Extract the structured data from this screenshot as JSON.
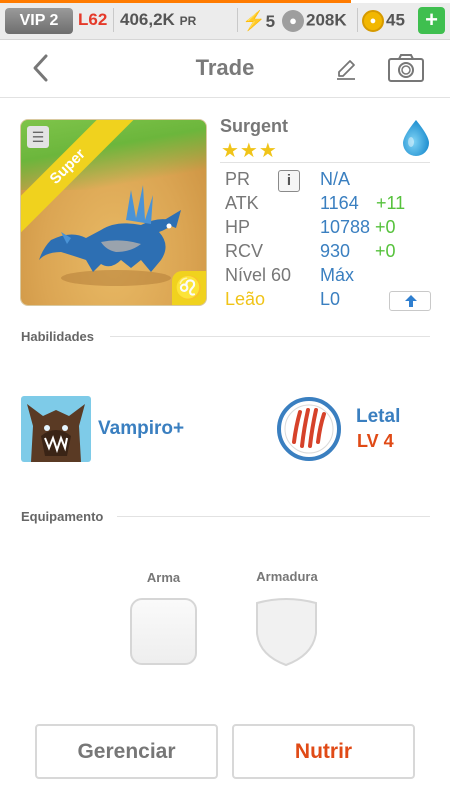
{
  "status_bar": {
    "vip": "VIP 2",
    "level": "L62",
    "power": "406,2K",
    "power_unit": "PR",
    "energy": "5",
    "food": "208K",
    "gold": "45",
    "add_label": "+"
  },
  "header": {
    "title": "Trade",
    "back_icon": "chevron-left-icon",
    "edit_icon": "pencil-icon",
    "camera_icon": "camera-icon"
  },
  "monster": {
    "name": "Surgent",
    "stars": "★★★",
    "badge": "Super",
    "element_icon": "water-drop-icon",
    "zodiac_icon": "leo-icon",
    "zodiac_glyph": "♌",
    "card_tag_glyph": "☰",
    "stats": {
      "pr_label": "PR",
      "pr_info": "i",
      "pr_value": "N/A",
      "atk_label": "ATK",
      "atk_value": "1164",
      "atk_bonus": "+11",
      "hp_label": "HP",
      "hp_value": "10788",
      "hp_bonus": "+0",
      "rcv_label": "RCV",
      "rcv_value": "930",
      "rcv_bonus": "+0",
      "level_label": "Nível 60",
      "level_value": "Máx",
      "zodiac_label": "Leão",
      "zodiac_value": "L0"
    }
  },
  "skills": {
    "title": "Habilidades",
    "skill1": {
      "name": "Vampiro+",
      "icon": "werewolf-icon"
    },
    "skill2": {
      "name": "Letal",
      "level": "LV 4",
      "icon": "claw-marks-icon"
    }
  },
  "equipment": {
    "title": "Equipamento",
    "weapon_label": "Arma",
    "armor_label": "Armadura"
  },
  "actions": {
    "manage": "Gerenciar",
    "feed": "Nutrir"
  },
  "colors": {
    "accent_blue": "#3a7fc0",
    "bonus_green": "#56c23c",
    "feed_orange": "#e04a16",
    "super_yellow": "#f0d21e",
    "level_red": "#e53a2a"
  }
}
